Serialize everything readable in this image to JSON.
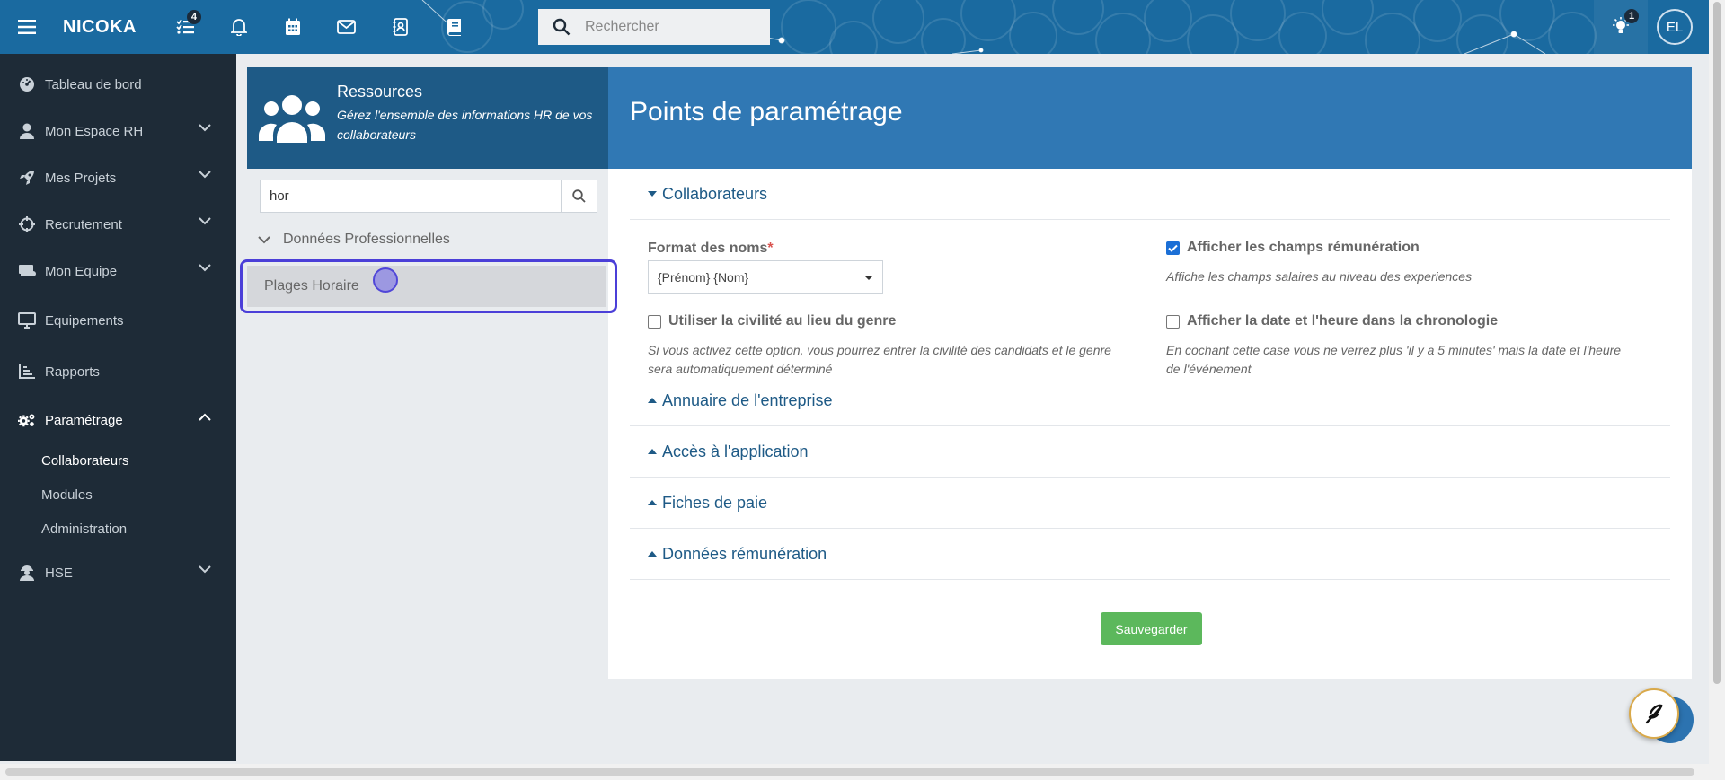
{
  "topbar": {
    "brand": "NICOKA",
    "tasks_badge": "4",
    "search_placeholder": "Rechercher",
    "bulb_badge": "1",
    "avatar_initials": "EL"
  },
  "sidebar": {
    "items": [
      {
        "label": "Tableau de bord",
        "icon": "dashboard-icon"
      },
      {
        "label": "Mon Espace RH",
        "icon": "user-icon"
      },
      {
        "label": "Mes Projets",
        "icon": "rocket-icon"
      },
      {
        "label": "Recrutement",
        "icon": "crosshair-icon"
      },
      {
        "label": "Mon Equipe",
        "icon": "team-icon"
      },
      {
        "label": "Equipements",
        "icon": "monitor-icon"
      },
      {
        "label": "Rapports",
        "icon": "chart-icon"
      },
      {
        "label": "Paramétrage",
        "icon": "cogs-icon"
      },
      {
        "label": "HSE",
        "icon": "worker-icon"
      }
    ],
    "sub_items": [
      "Collaborateurs",
      "Modules",
      "Administration"
    ]
  },
  "resources": {
    "title": "Ressources",
    "description": "Gérez l'ensemble des informations HR de vos collaborateurs"
  },
  "left_panel": {
    "search_value": "hor",
    "group_label": "Données Professionnelles",
    "leaf_label": "Plages Horaire"
  },
  "main": {
    "title": "Points de paramétrage",
    "sections": [
      "Collaborateurs",
      "Annuaire de l'entreprise",
      "Accès à l'application",
      "Fiches de paie",
      "Données rémunération"
    ],
    "format_label": "Format des noms",
    "required_mark": "*",
    "format_value": "{Prénom} {Nom}",
    "civilite_label": "Utiliser la civilité au lieu du genre",
    "civilite_help": "Si vous activez cette option, vous pourrez entrer la civilité des candidats et le genre sera automatiquement déterminé",
    "remuneration_label": "Afficher les champs rémunération",
    "remuneration_help": "Affiche les champs salaires au niveau des experiences",
    "remuneration_checked": true,
    "date_label": "Afficher la date et l'heure dans la chronologie",
    "date_help": "En cochant cette case vous ne verrez plus 'il y a 5 minutes' mais la date et l'heure de l'événement",
    "save_label": "Sauvegarder"
  },
  "colors": {
    "topbar": "#1a6aa0",
    "sidebar": "#1e2b37",
    "header_dark": "#1e5a86",
    "header_light": "#3078b4",
    "save_button": "#5cb85c",
    "highlight": "#4b3fd8"
  }
}
